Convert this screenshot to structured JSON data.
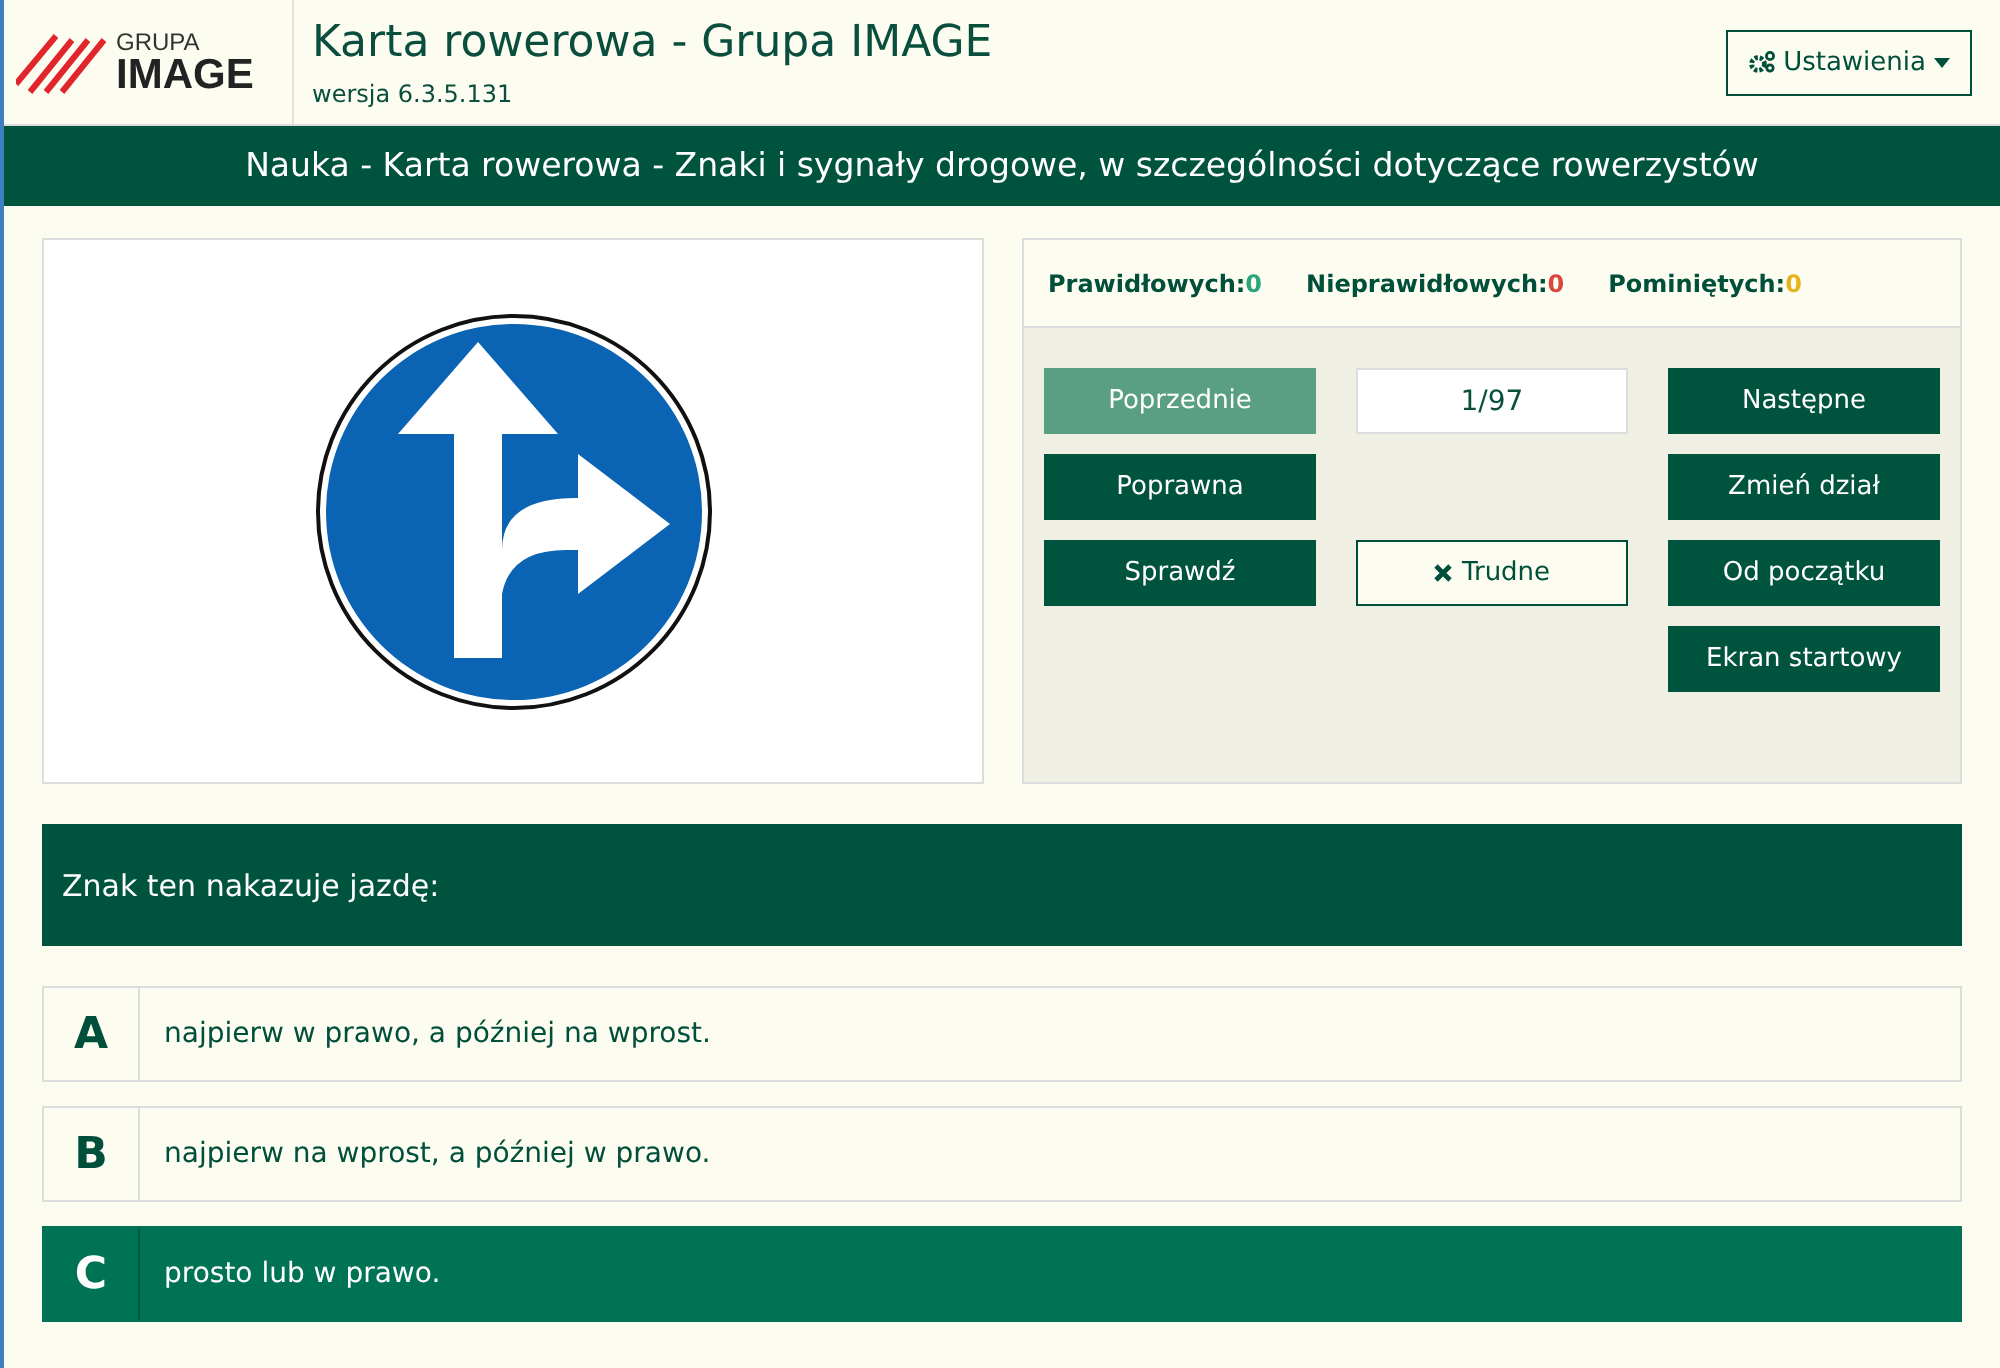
{
  "header": {
    "logo_top": "GRUPA",
    "logo_bottom": "IMAGE",
    "title": "Karta rowerowa - Grupa IMAGE",
    "version": "wersja 6.3.5.131",
    "settings_button": "Ustawienia"
  },
  "section_title": "Nauka - Karta rowerowa - Znaki i sygnały drogowe, w szczególności dotyczące rowerzystów",
  "stats": [
    {
      "label": "Prawidłowych:",
      "value": "0",
      "color": "#2aa57c"
    },
    {
      "label": "Nieprawidłowych:",
      "value": "0",
      "color": "#d9463e"
    },
    {
      "label": "Pominiętych:",
      "value": "0",
      "color": "#e6b21e"
    }
  ],
  "left_buttons": [
    {
      "label": "Poprzednie",
      "disabled": true
    },
    {
      "label": "Poprawna",
      "disabled": false
    },
    {
      "label": "Sprawdź",
      "disabled": false
    }
  ],
  "counter": "1/97",
  "difficult_button": "Trudne",
  "right_buttons": [
    {
      "label": "Następne",
      "disabled": false
    },
    {
      "label": "Zmień dział",
      "disabled": false
    },
    {
      "label": "Od początku",
      "disabled": false
    },
    {
      "label": "Ekran startowy",
      "disabled": false
    }
  ],
  "question": "Znak ten nakazuje jazdę:",
  "answers": [
    {
      "letter": "A",
      "text": "najpierw w prawo, a później na wprost.",
      "selected": false
    },
    {
      "letter": "B",
      "text": "najpierw na wprost, a później w prawo.",
      "selected": false
    },
    {
      "letter": "C",
      "text": "prosto lub w prawo.",
      "selected": true
    }
  ]
}
